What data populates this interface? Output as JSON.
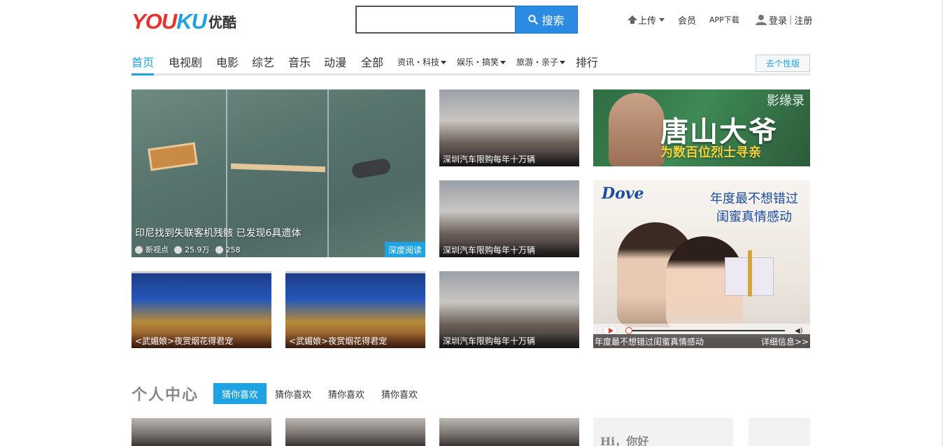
{
  "header": {
    "logo_text": "YOUKU",
    "logo_cn": "优酷",
    "search": {
      "value": "",
      "placeholder": "",
      "button_label": "搜索"
    },
    "upload_label": "上传",
    "member_label": "会员",
    "app_download_label": "APP下载",
    "login_label": "登录",
    "register_label": "注册"
  },
  "nav": {
    "items": [
      {
        "label": "首页"
      },
      {
        "label": "电视剧"
      },
      {
        "label": "电影"
      },
      {
        "label": "综艺"
      },
      {
        "label": "音乐"
      },
      {
        "label": "动漫"
      },
      {
        "label": "全部"
      },
      {
        "label": "资讯・科技"
      },
      {
        "label": "娱乐・搞笑"
      },
      {
        "label": "旅游・亲子"
      },
      {
        "label": "排行"
      }
    ],
    "personalize_label": "去个性版"
  },
  "hero": {
    "title": "印尼找到失联客机残骸 已发现6具遗体",
    "source": "新视点",
    "plays": "25.9万",
    "comments": "258",
    "badge": "深度阅读"
  },
  "tiles": {
    "train_caption": "深圳汽车限购每年十万辆",
    "drama_caption": "<武媚娘>夜赏烟花得君宠"
  },
  "ads": {
    "tangshan_brand": "影缘录",
    "tangshan_title": "唐山大爷",
    "tangshan_subtitle": "为数百位烈士寻亲",
    "dove_brand": "Dove",
    "dove_slogan_line1": "年度最不想错过",
    "dove_slogan_line2": "闺蜜真情感动",
    "dove_caption": "年度最不想错过闺蜜真情感动",
    "dove_details": "详细信息>>"
  },
  "personal": {
    "title": "个人中心",
    "tabs": [
      {
        "label": "猜你喜欢"
      },
      {
        "label": "猜你喜欢"
      },
      {
        "label": "猜你喜欢"
      },
      {
        "label": "猜你喜欢"
      }
    ],
    "greeting": "Hi，你好"
  },
  "colors": {
    "accent": "#1ea2e2",
    "search_button": "#2b8ae1",
    "logo_red": "#e8322e"
  }
}
